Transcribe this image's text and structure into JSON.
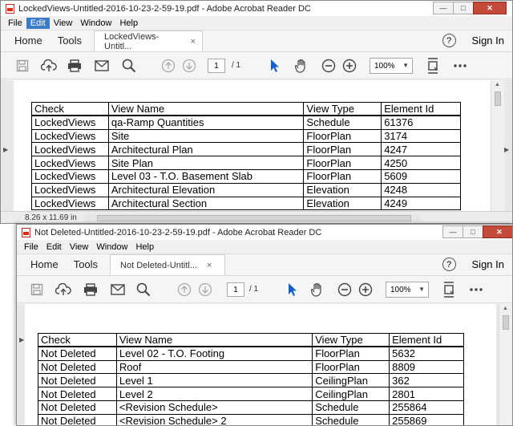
{
  "window1": {
    "title": "LockedViews-Untitled-2016-10-23-2-59-19.pdf - Adobe Acrobat Reader DC",
    "menu": [
      "File",
      "Edit",
      "View",
      "Window",
      "Help"
    ],
    "active_menu": "Edit",
    "nav_home": "Home",
    "nav_tools": "Tools",
    "doc_tab": "LockedViews-Untitl...",
    "tab_close": "×",
    "sign_in": "Sign In",
    "help_glyph": "?",
    "page_current": "1",
    "page_total": "/ 1",
    "zoom": "100%",
    "status_dims": "8.26 x 11.69 in",
    "table": {
      "headers": [
        "Check",
        "View Name",
        "View Type",
        "Element Id"
      ],
      "rows": [
        [
          "LockedViews",
          "qa-Ramp Quantities",
          "Schedule",
          "61376"
        ],
        [
          "LockedViews",
          "Site",
          "FloorPlan",
          "3174"
        ],
        [
          "LockedViews",
          "Architectural Plan",
          "FloorPlan",
          "4247"
        ],
        [
          "LockedViews",
          "Site Plan",
          "FloorPlan",
          "4250"
        ],
        [
          "LockedViews",
          "Level 03 - T.O. Basement Slab",
          "FloorPlan",
          "5609"
        ],
        [
          "LockedViews",
          "Architectural Elevation",
          "Elevation",
          "4248"
        ],
        [
          "LockedViews",
          "Architectural Section",
          "Elevation",
          "4249"
        ]
      ]
    }
  },
  "window2": {
    "title": "Not Deleted-Untitled-2016-10-23-2-59-19.pdf - Adobe Acrobat Reader DC",
    "menu": [
      "File",
      "Edit",
      "View",
      "Window",
      "Help"
    ],
    "nav_home": "Home",
    "nav_tools": "Tools",
    "doc_tab": "Not Deleted-Untitl...",
    "tab_close": "×",
    "sign_in": "Sign In",
    "help_glyph": "?",
    "page_current": "1",
    "page_total": "/ 1",
    "zoom": "100%",
    "table": {
      "headers": [
        "Check",
        "View Name",
        "View Type",
        "Element Id"
      ],
      "rows": [
        [
          "Not Deleted",
          "Level 02 - T.O. Footing",
          "FloorPlan",
          "5632"
        ],
        [
          "Not Deleted",
          "Roof",
          "FloorPlan",
          "8809"
        ],
        [
          "Not Deleted",
          "Level 1",
          "CeilingPlan",
          "362"
        ],
        [
          "Not Deleted",
          "Level 2",
          "CeilingPlan",
          "2801"
        ],
        [
          "Not Deleted",
          "<Revision Schedule>",
          "Schedule",
          "255864"
        ],
        [
          "Not Deleted",
          "<Revision Schedule> 2",
          "Schedule",
          "255869"
        ]
      ]
    }
  },
  "window_controls": {
    "minimize": "—",
    "maximize": "□",
    "close": "✕"
  },
  "colors": {
    "menu_highlight": "#3b7bc8",
    "select_tool": "#1a5fc4",
    "close_button": "#c44b3c"
  }
}
